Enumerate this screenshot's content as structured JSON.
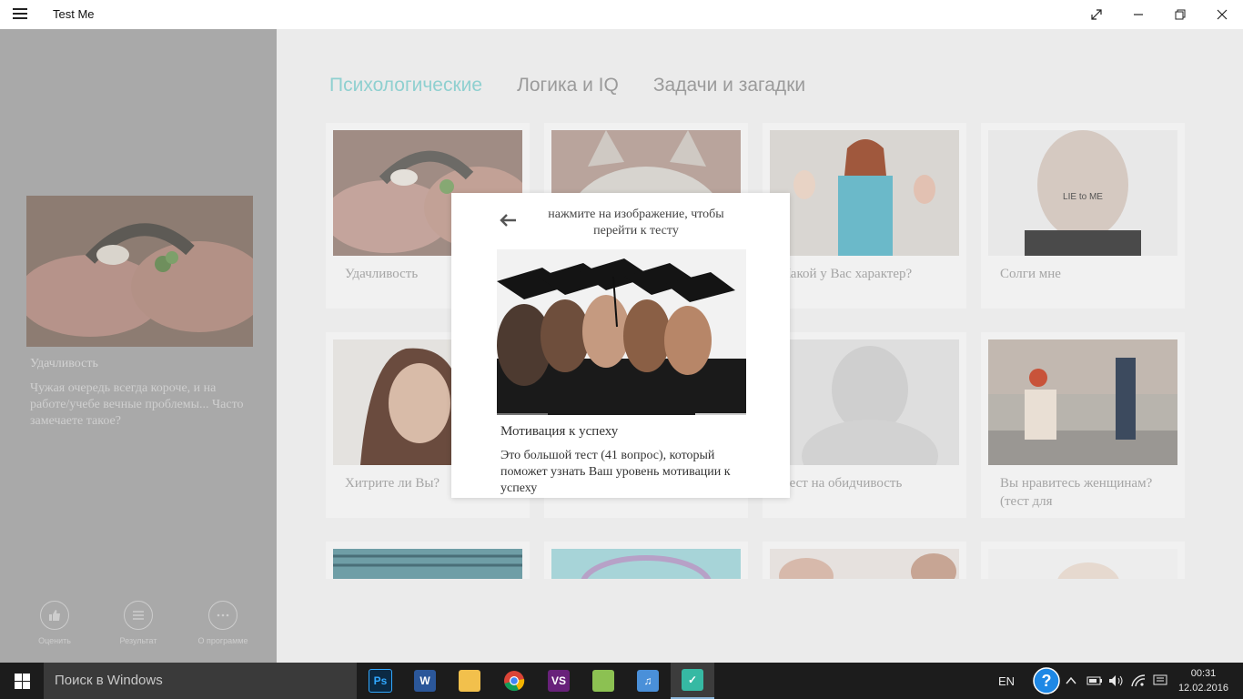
{
  "window": {
    "title": "Test Me",
    "controls": [
      "fullscreen-icon",
      "minimize-icon",
      "restore-icon",
      "close-icon"
    ]
  },
  "sidebar": {
    "title": "Удачливость",
    "description": "Чужая очередь всегда короче, и на работе/учебе вечные проблемы... Часто замечаете такое?",
    "buttons": [
      {
        "label": "Оценить",
        "icon": "thumbs-up-icon"
      },
      {
        "label": "Результат",
        "icon": "list-icon"
      },
      {
        "label": "О программе",
        "icon": "more-icon"
      }
    ]
  },
  "tabs": [
    {
      "label": "Психологические",
      "active": true
    },
    {
      "label": "Логика и IQ",
      "active": false
    },
    {
      "label": "Задачи и загадки",
      "active": false
    }
  ],
  "cards": [
    {
      "title": "Удачливость"
    },
    {
      "title": ""
    },
    {
      "title": "Какой у Вас характер?"
    },
    {
      "title": "Солги мне"
    },
    {
      "title": "Хитрите ли Вы?"
    },
    {
      "title": ""
    },
    {
      "title": "Тест на обидчивость"
    },
    {
      "title": "Вы нравитесь женщинам? (тест для"
    },
    {
      "title": ""
    },
    {
      "title": ""
    },
    {
      "title": ""
    },
    {
      "title": ""
    }
  ],
  "popup": {
    "hint": "нажмите на изображение, чтобы перейти к тесту",
    "title": "Мотивация к успеху",
    "description": "Это большой тест (41 вопрос), который поможет узнать Ваш уровень мотивации к успеху",
    "prev": "‹",
    "next": "›"
  },
  "taskbar": {
    "search_placeholder": "Поиск в Windows",
    "apps": [
      "photoshop-icon",
      "word-icon",
      "file-explorer-icon",
      "chrome-icon",
      "visual-studio-icon",
      "folders-icon",
      "music-icon",
      "test-me-icon"
    ],
    "language": "EN",
    "time": "00:31",
    "date": "12.02.2016"
  },
  "colors": {
    "accent_tab": "#8fd0d0",
    "sidebar_bg": "#a9a9a9",
    "taskbar_bg": "#1c1c1c"
  }
}
